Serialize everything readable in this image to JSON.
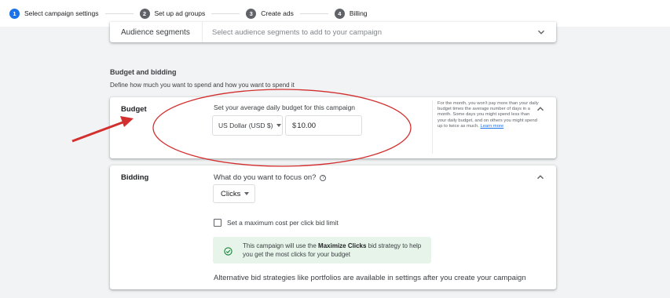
{
  "stepper": {
    "steps": [
      {
        "num": "1",
        "label": "Select campaign settings"
      },
      {
        "num": "2",
        "label": "Set up ad groups"
      },
      {
        "num": "3",
        "label": "Create ads"
      },
      {
        "num": "4",
        "label": "Billing"
      }
    ],
    "active_step": 1
  },
  "audience": {
    "label": "Audience segments",
    "placeholder": "Select audience segments to add to your campaign"
  },
  "budget_section": {
    "title": "Budget and bidding",
    "subtitle": "Define how much you want to spend and how you want to spend it"
  },
  "budget": {
    "label": "Budget",
    "prompt": "Set your average daily budget for this campaign",
    "currency": "US Dollar (USD $)",
    "currency_symbol": "$",
    "amount": "10.00",
    "help": "For the month, you won't pay more than your daily budget times the average number of days in a month. Some days you might spend less than your daily budget, and on others you might spend up to twice as much.",
    "help_link": "Learn more"
  },
  "bidding": {
    "label": "Bidding",
    "question": "What do you want to focus on?",
    "help_icon": "?",
    "focus_value": "Clicks",
    "checkbox_label": "Set a maximum cost per click bid limit",
    "strategy_prefix": "This campaign will use the ",
    "strategy_bold": "Maximize Clicks",
    "strategy_suffix": " bid strategy to help you get the most clicks for your budget",
    "alternative": "Alternative bid strategies like portfolios are available in settings after you create your campaign"
  },
  "colors": {
    "accent": "#1a73e8",
    "annotation": "#d32f2f",
    "success_bg": "#e6f4ea",
    "success_icon": "#188038"
  },
  "icons": [
    "chevron-down-icon",
    "chevron-up-icon",
    "dropdown-caret-icon",
    "help-circle-icon",
    "check-circle-icon",
    "red-arrow-annotation",
    "red-ellipse-annotation"
  ]
}
